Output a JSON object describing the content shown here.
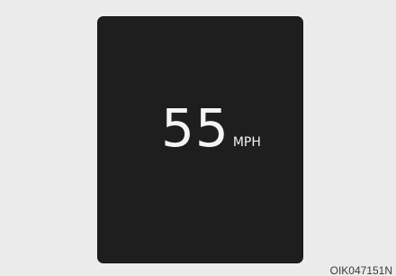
{
  "display": {
    "speed_value": "55",
    "speed_unit": "MPH"
  },
  "figure_code": "OIK047151N",
  "colors": {
    "page_background": "#ebebeb",
    "panel_background": "#1e1e1e",
    "text": "#f4f4f4"
  }
}
